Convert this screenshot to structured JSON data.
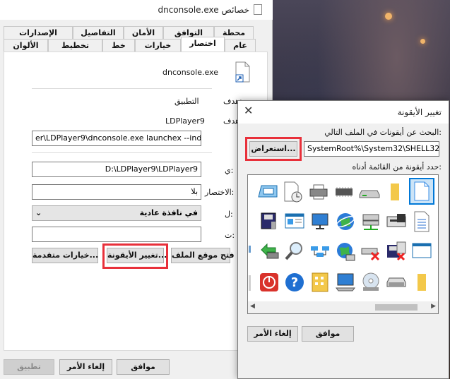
{
  "props_window": {
    "title": "خصائص dnconsole.exe",
    "tabs_row1": [
      "محطة طرفية",
      "التوافق",
      "الأمان",
      "التفاصيل",
      "الإصدارات السابقة"
    ],
    "tabs_row2": [
      "عام",
      "اختصار",
      "خيارات",
      "خط",
      "تخطيط",
      "الألوان"
    ],
    "active_tab": "اختصار",
    "file_name": "dnconsole.exe",
    "target_type_label": "هدف:",
    "target_type_value": "التطبيق",
    "target_location_label": "هدف:",
    "target_location_value": "LDPlayer9",
    "target_field": "er\\LDPlayer9\\dnconsole.exe launchex --index 1 --",
    "start_in_label": "ي:",
    "start_in_field": "D:\\LDPlayer9\\LDPlayer9",
    "shortcut_key_label": "الاختصار:",
    "shortcut_key_field": "بلا",
    "run_label": "ل:",
    "run_select": "في نافذة عادية",
    "comment_label": "ت:",
    "comment_field": "",
    "open_location_button": "فتح موقع الملف",
    "change_icon_button": "تغيير الأيقونة...",
    "advanced_button": "خيارات متقدمة...",
    "ok_button": "موافق",
    "cancel_button": "إلغاء الأمر",
    "apply_button": "تطبيق"
  },
  "change_icon_dialog": {
    "title": "تغيير الأيقونة",
    "look_for_label": "البحث عن أيقونات في الملف التالي:",
    "file_path": "SystemRoot%\\System32\\SHELL32.dll",
    "browse_button": "استعراض...",
    "select_label": "حدد أيقونة من القائمة أدناه:",
    "ok_button": "موافق",
    "cancel_button": "إلغاء الأمر"
  },
  "colors": {
    "highlight": "#e8303a",
    "selection": "#0078d7"
  },
  "icons": [
    [
      "file-icon-selected",
      "folder-icon",
      "drive-icon",
      "chip-icon",
      "printer-icon",
      "clock-document-icon",
      "window-icon"
    ],
    [
      "document-lines-icon",
      "disk-drive-icon",
      "network-drive-icon",
      "globe-icon",
      "monitor-icon",
      "control-panel-icon",
      "floppy-icon"
    ],
    [
      "window-frame-icon",
      "floppy-delete-icon",
      "drive-delete-icon",
      "globe-network-icon",
      "network-icon",
      "magnifier-icon",
      "green-arrow-icon"
    ],
    [
      "folder-small-icon",
      "hdd-icon",
      "cd-icon",
      "computer-icon",
      "folder-grid-icon",
      "help-icon",
      "shutdown-icon"
    ]
  ]
}
